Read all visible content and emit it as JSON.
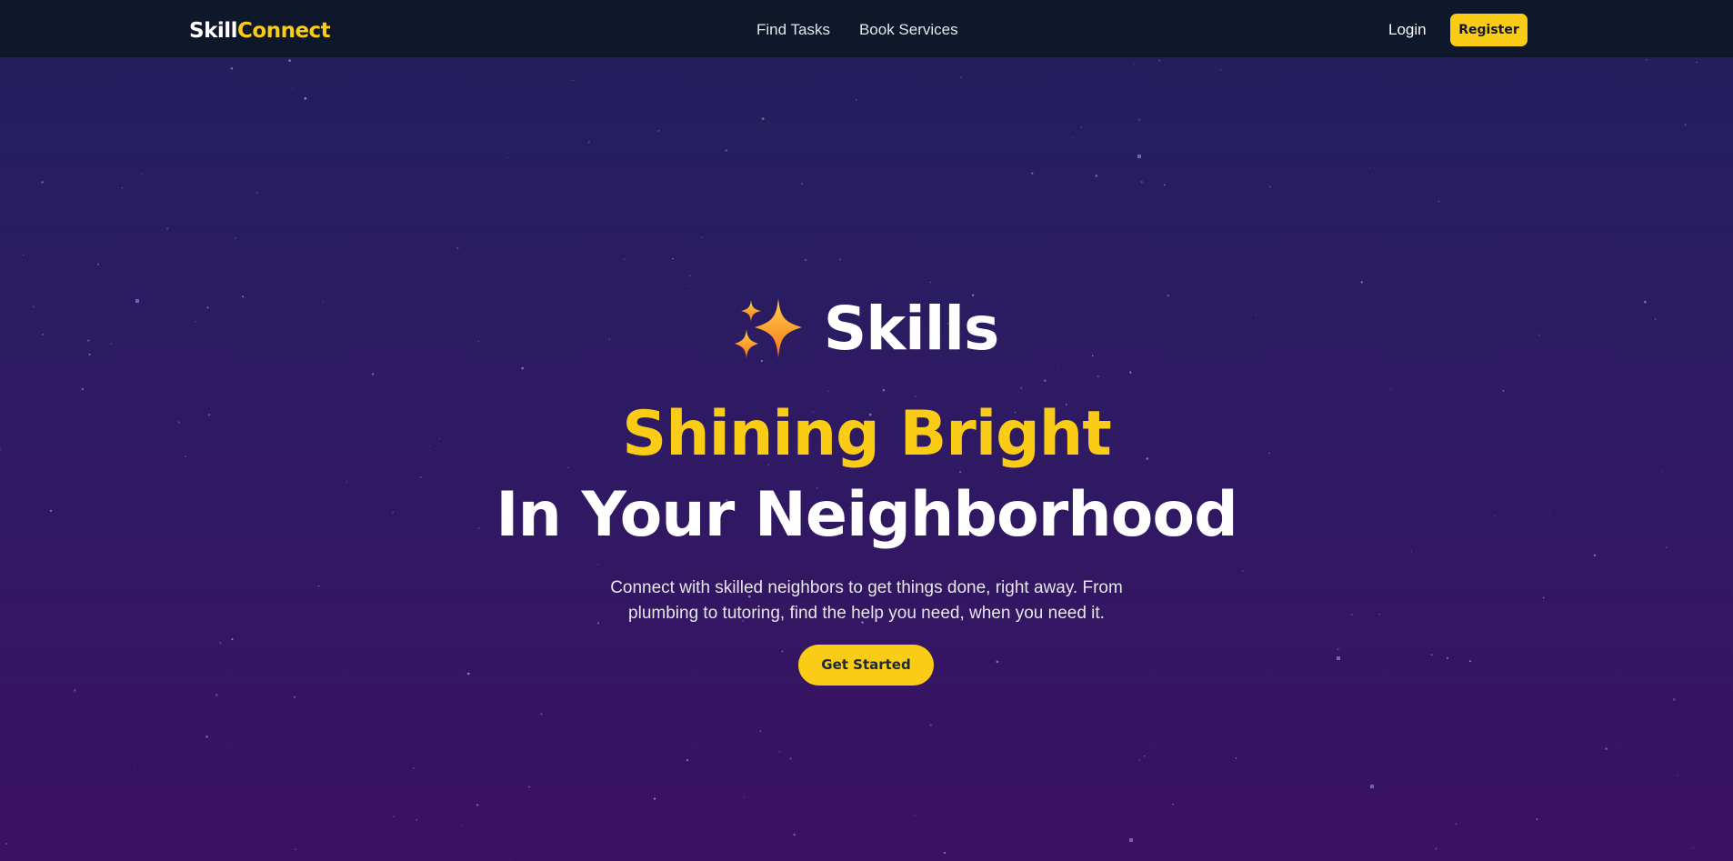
{
  "navbar": {
    "brand_part1": "Skill",
    "brand_part2": "Connect",
    "links": [
      "Find Tasks",
      "Book Services"
    ],
    "login_label": "Login",
    "register_label": "Register"
  },
  "hero": {
    "icon": "sparkles-icon",
    "title_word": "Skills",
    "line_yellow": "Shining Bright",
    "line_white": "In Your Neighborhood",
    "subtitle": "Connect with skilled neighbors to get things done, right away. From plumbing to tutoring, find the help you need, when you need it.",
    "cta_label": "Get Started"
  },
  "colors": {
    "nav_background": "#0f172a",
    "accent": "#facc15",
    "gradient_top": "#221f5c",
    "gradient_bottom": "#3b1163"
  }
}
